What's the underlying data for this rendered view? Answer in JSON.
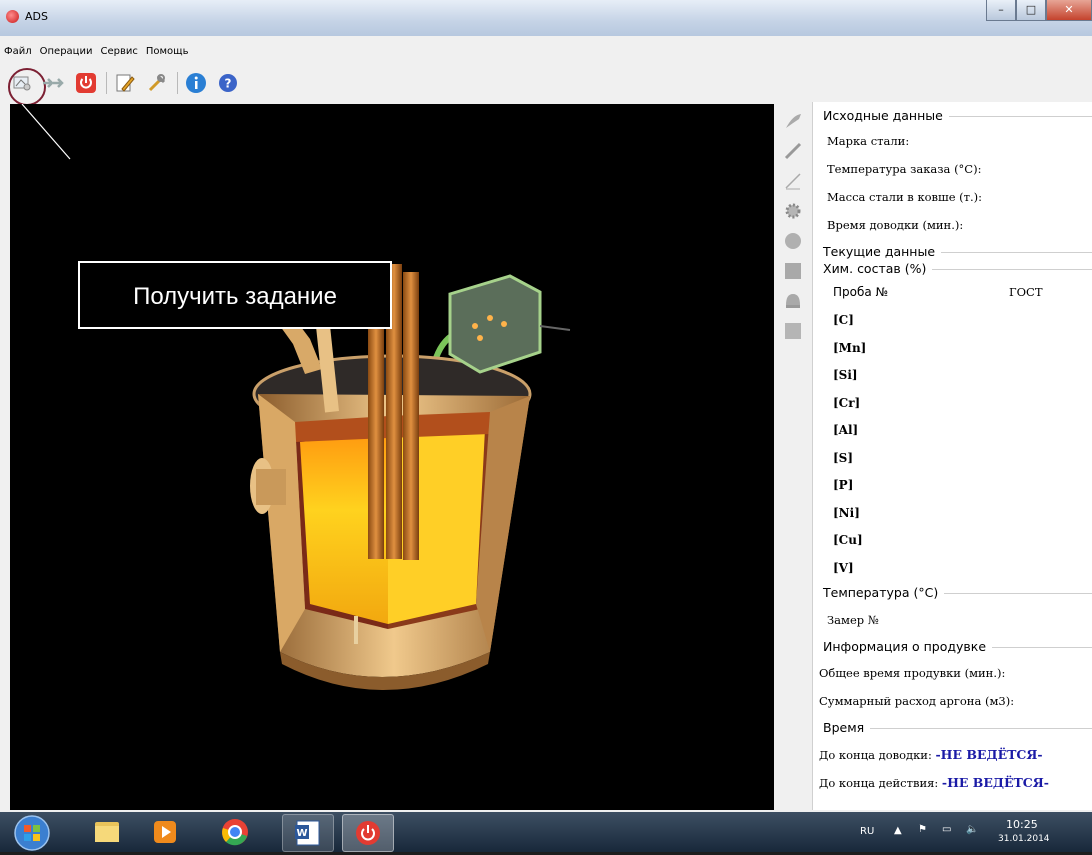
{
  "window": {
    "title": "ADS",
    "controls": [
      "–",
      "□",
      "✕"
    ]
  },
  "menu": [
    "Файл",
    "Операции",
    "Сервис",
    "Помощь"
  ],
  "toolbar": [
    {
      "name": "get-task-icon"
    },
    {
      "name": "forward-arrows-icon"
    },
    {
      "name": "power-stop-icon"
    },
    {
      "name": "edit-notes-icon"
    },
    {
      "name": "tools-icon"
    },
    {
      "name": "info-icon"
    },
    {
      "name": "help-icon"
    }
  ],
  "callout": {
    "text": "Получить задание"
  },
  "panel": {
    "initial": {
      "title": "Исходные данные",
      "rows": [
        "Марка стали:",
        "Температура заказа (°C):",
        "Масса стали в ковше (т.):",
        "Время доводки (мин.):"
      ]
    },
    "current": {
      "title": "Текущие данные"
    },
    "chem": {
      "title": "Хим. состав (%)",
      "sample_label": "Проба №",
      "gost_label": "ГОСТ",
      "elements": [
        "[C]",
        "[Mn]",
        "[Si]",
        "[Cr]",
        "[Al]",
        "[S]",
        "[P]",
        "[Ni]",
        "[Cu]",
        "[V]"
      ]
    },
    "temperature": {
      "title": "Температура (°C)",
      "measure_label": "Замер №"
    },
    "blow": {
      "title": "Информация о продувке",
      "rows": [
        "Общее время продувки (мин.):",
        "Суммарный расход аргона (м3):"
      ]
    },
    "time": {
      "title": "Время",
      "rows": [
        {
          "label": "До конца доводки:",
          "value": "-НЕ ВЕДЁТСЯ-"
        },
        {
          "label": "До конца действия:",
          "value": "-НЕ ВЕДЁТСЯ-"
        }
      ]
    }
  },
  "taskbar": {
    "lang": "RU",
    "time": "10:25",
    "date": "31.01.2014"
  }
}
